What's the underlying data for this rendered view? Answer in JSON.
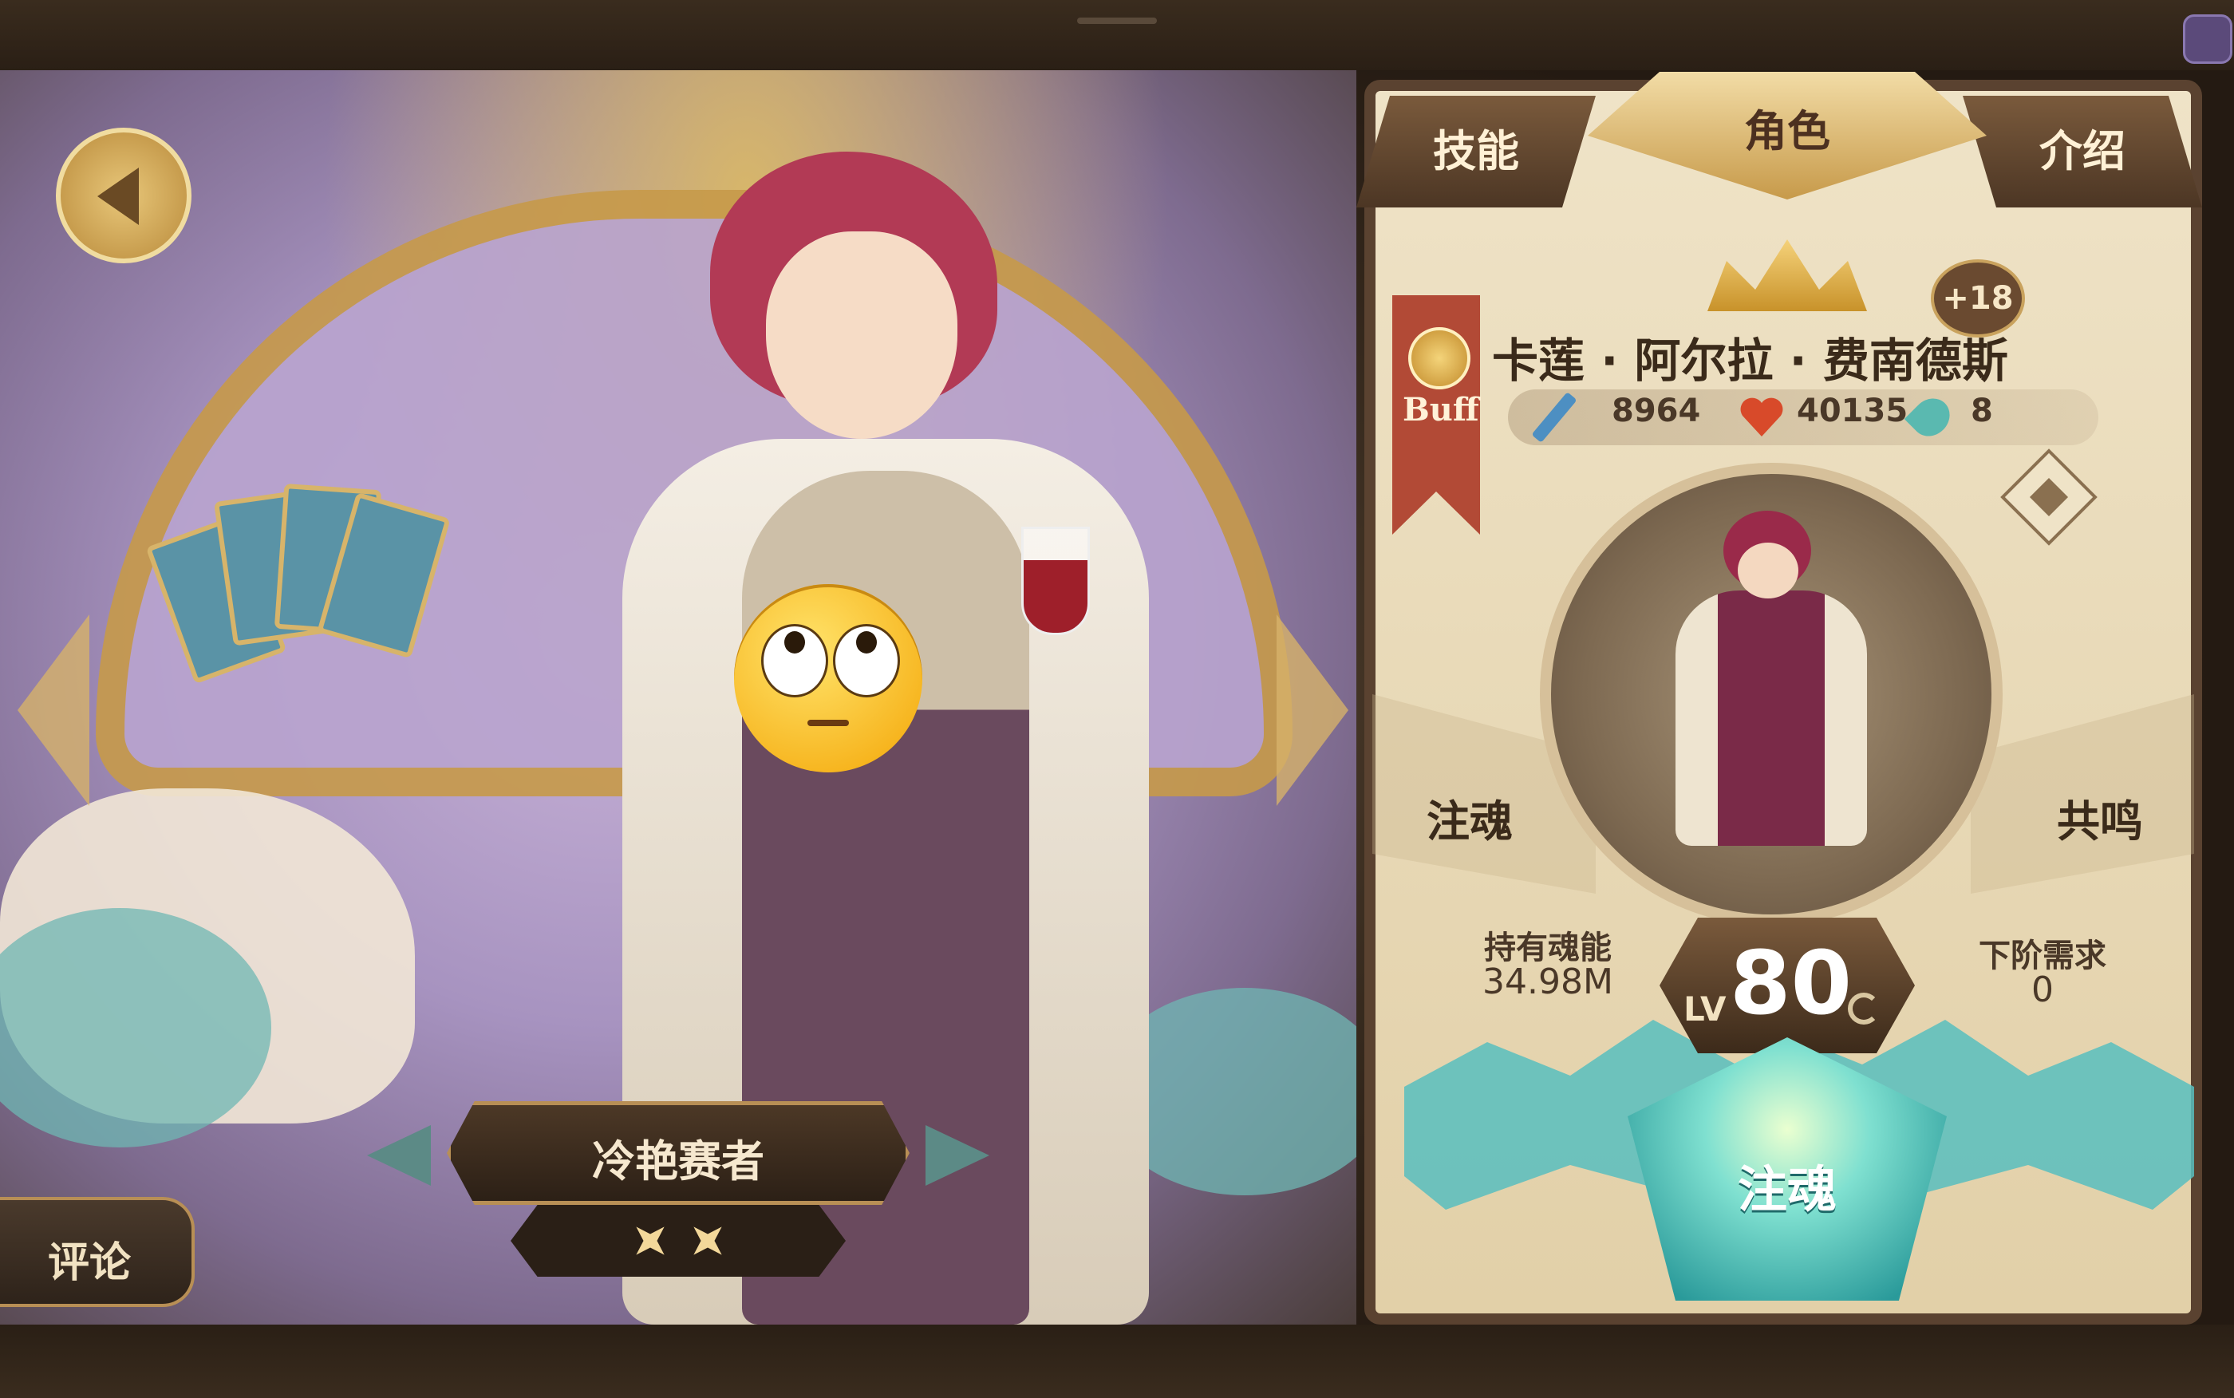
{
  "tabs": {
    "skill": "技能",
    "role": "角色",
    "intro": "介绍"
  },
  "character": {
    "name": "卡莲 · 阿尔拉 · 费南德斯",
    "title": "冷艳赛者",
    "plus_badge": "+18",
    "buff_label": "Buff",
    "stars": 2
  },
  "stats": {
    "attack": "8964",
    "health": "40135",
    "soul": "8"
  },
  "panel": {
    "left_label": "注魂",
    "right_label": "共鸣",
    "owned_soul_label": "持有魂能",
    "owned_soul_value": "34.98M",
    "next_req_label": "下阶需求",
    "next_req_value": "0",
    "level_prefix": "LV",
    "level": "80",
    "infuse_button": "注魂"
  },
  "buttons": {
    "comment": "评论"
  },
  "icons": {
    "back": "back-arrow-icon",
    "attack": "sword-icon",
    "health": "heart-icon",
    "soul": "soul-flame-icon",
    "favorite": "heart-diamond-icon",
    "refresh": "refresh-icon",
    "star": "star-icon"
  },
  "colors": {
    "panel_bg": "#efe3c7",
    "frame": "#5a4230",
    "accent_gold": "#c79a4a",
    "teal": "#58bebe",
    "health_red": "#d84a2a"
  }
}
